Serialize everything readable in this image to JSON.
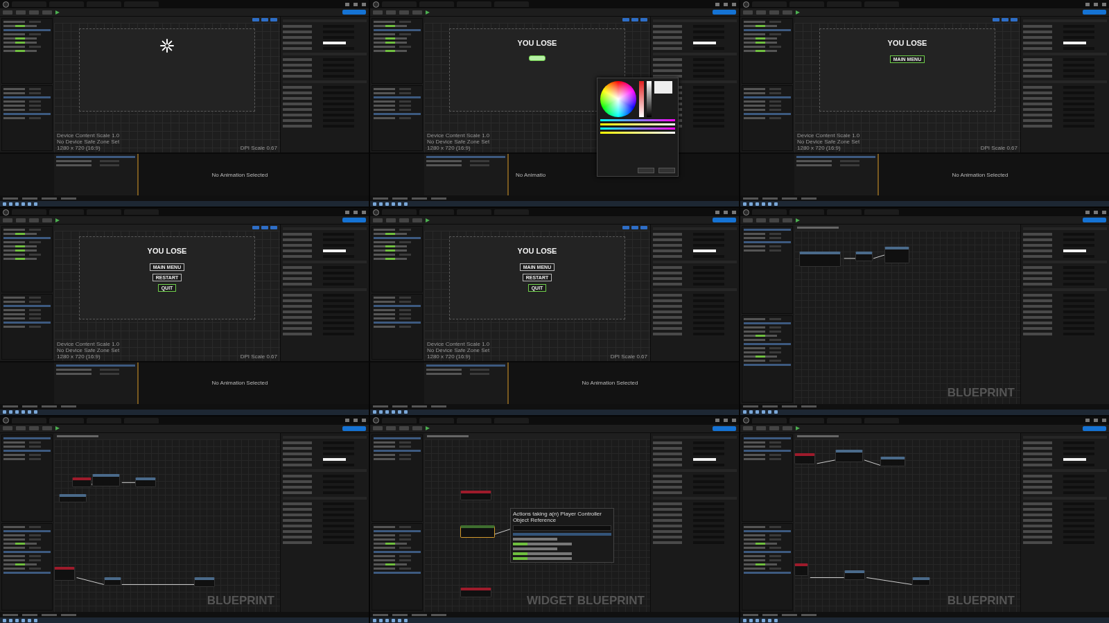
{
  "tiles": [
    {
      "kind": "designer",
      "spinner": true,
      "info": [
        "Device Content Scale 1.0",
        "No Device Safe Zone Set",
        "1280 x 720 (16:9)"
      ],
      "dpi": "DPI Scale 0.67",
      "animation_message": "No Animation Selected"
    },
    {
      "kind": "designer",
      "heading": "YOU LOSE",
      "buttons": [
        {
          "kind": "blank",
          "selected": true
        }
      ],
      "color_picker": true,
      "info": [
        "Device Content Scale 1.0",
        "No Device Safe Zone Set",
        "1280 x 720 (16:9)"
      ],
      "animation_message": "No Animatio"
    },
    {
      "kind": "designer",
      "heading": "YOU LOSE",
      "buttons": [
        {
          "kind": "text",
          "label": "MAIN MENU",
          "selected": true
        }
      ],
      "info": [
        "Device Content Scale 1.0",
        "No Device Safe Zone Set",
        "1280 x 720 (16:9)"
      ],
      "dpi": "DPI Scale 0.67",
      "animation_message": "No Animation Selected"
    },
    {
      "kind": "designer",
      "heading": "YOU LOSE",
      "buttons": [
        {
          "kind": "text",
          "label": "MAIN MENU",
          "selected": false
        },
        {
          "kind": "text",
          "label": "RESTART",
          "selected": false
        },
        {
          "kind": "text",
          "label": "QUIT",
          "selected": true
        }
      ],
      "info": [
        "Device Content Scale 1.0",
        "No Device Safe Zone Set",
        "1280 x 720 (16:9)"
      ],
      "dpi": "DPI Scale 0.67",
      "animation_message": "No Animation Selected"
    },
    {
      "kind": "designer",
      "heading": "YOU LOSE",
      "buttons": [
        {
          "kind": "text",
          "label": "MAIN MENU",
          "selected": false
        },
        {
          "kind": "text",
          "label": "RESTART",
          "selected": false
        },
        {
          "kind": "text",
          "label": "QUIT",
          "selected": true
        }
      ],
      "info": [
        "Device Content Scale 1.0",
        "No Device Safe Zone Set",
        "1280 x 720 (16:9)"
      ],
      "dpi": "DPI Scale 0.67",
      "animation_message": "No Animation Selected"
    },
    {
      "kind": "graph",
      "watermark": "BLUEPRINT"
    },
    {
      "kind": "graph",
      "watermark": "BLUEPRINT"
    },
    {
      "kind": "graph",
      "watermark": "WIDGET BLUEPRINT",
      "context_menu": {
        "title": "Actions taking a(n) Player Controller Object Reference"
      }
    },
    {
      "kind": "graph",
      "watermark": "BLUEPRINT"
    }
  ]
}
